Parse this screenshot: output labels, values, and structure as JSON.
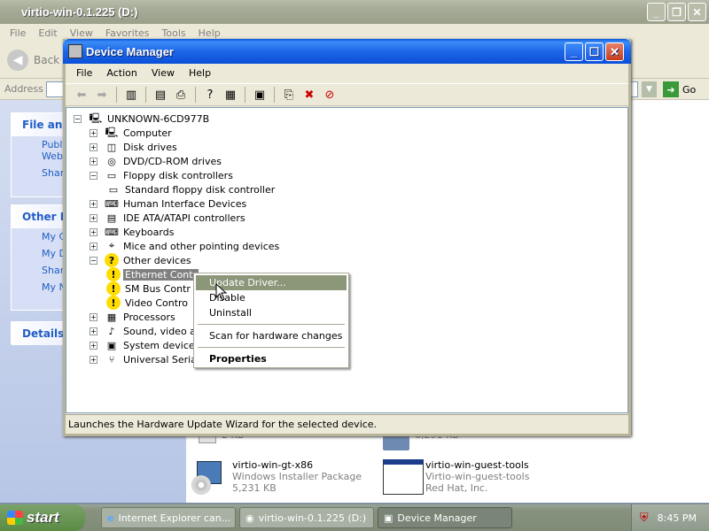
{
  "background_window": {
    "title": "virtio-win-0.1.225 (D:)",
    "menu": [
      "File",
      "Edit",
      "View",
      "Favorites",
      "Tools",
      "Help"
    ],
    "back_label": "Back",
    "address_label": "Address",
    "go_label": "Go",
    "panels": {
      "file_folder": {
        "title": "File and",
        "items": [
          "Publi\nWeb",
          "Shar"
        ]
      },
      "other_places": {
        "title": "Other Pl",
        "items": [
          "My C",
          "My D",
          "Shar",
          "My N"
        ]
      },
      "details": {
        "title": "Details"
      }
    },
    "files": [
      {
        "name": "",
        "sub": "2 KB"
      },
      {
        "name": "",
        "sub": "6,291 KB"
      },
      {
        "name": "virtio-win-gt-x86",
        "sub1": "Windows Installer Package",
        "sub2": "5,231 KB"
      },
      {
        "name": "virtio-win-guest-tools",
        "sub1": "Virtio-win-guest-tools",
        "sub2": "Red Hat, Inc."
      }
    ]
  },
  "device_manager": {
    "title": "Device Manager",
    "menu": [
      "File",
      "Action",
      "View",
      "Help"
    ],
    "root": "UNKNOWN-6CD977B",
    "tree": [
      {
        "label": "Computer",
        "exp": "+",
        "icon": "computer-icon"
      },
      {
        "label": "Disk drives",
        "exp": "+",
        "icon": "disk-icon"
      },
      {
        "label": "DVD/CD-ROM drives",
        "exp": "+",
        "icon": "cdrom-icon"
      },
      {
        "label": "Floppy disk controllers",
        "exp": "−",
        "icon": "floppy-icon"
      },
      {
        "label": "Standard floppy disk controller",
        "child": true,
        "icon": "floppy-controller-icon"
      },
      {
        "label": "Human Interface Devices",
        "exp": "+",
        "icon": "hid-icon"
      },
      {
        "label": "IDE ATA/ATAPI controllers",
        "exp": "+",
        "icon": "ide-icon"
      },
      {
        "label": "Keyboards",
        "exp": "+",
        "icon": "keyboard-icon"
      },
      {
        "label": "Mice and other pointing devices",
        "exp": "+",
        "icon": "mouse-icon"
      },
      {
        "label": "Other devices",
        "exp": "−",
        "icon": "unknown-device-icon"
      },
      {
        "label": "Ethernet Contr",
        "child": true,
        "warn": true,
        "selected": true
      },
      {
        "label": "SM Bus Contr",
        "child": true,
        "warn": true
      },
      {
        "label": "Video Contro",
        "child": true,
        "warn": true
      },
      {
        "label": "Processors",
        "exp": "+",
        "icon": "processor-icon"
      },
      {
        "label": "Sound, video and",
        "exp": "+",
        "icon": "sound-icon"
      },
      {
        "label": "System devices",
        "exp": "+",
        "icon": "system-icon"
      },
      {
        "label": "Universal Serial B",
        "exp": "+",
        "icon": "usb-icon"
      }
    ],
    "status": "Launches the Hardware Update Wizard for the selected device."
  },
  "context_menu": {
    "items": [
      "Update Driver...",
      "Disable",
      "Uninstall",
      "Scan for hardware changes",
      "Properties"
    ]
  },
  "taskbar": {
    "start": "start",
    "tasks": [
      "Internet Explorer can...",
      "virtio-win-0.1.225 (D:)",
      "Device Manager"
    ],
    "clock": "8:45 PM"
  }
}
